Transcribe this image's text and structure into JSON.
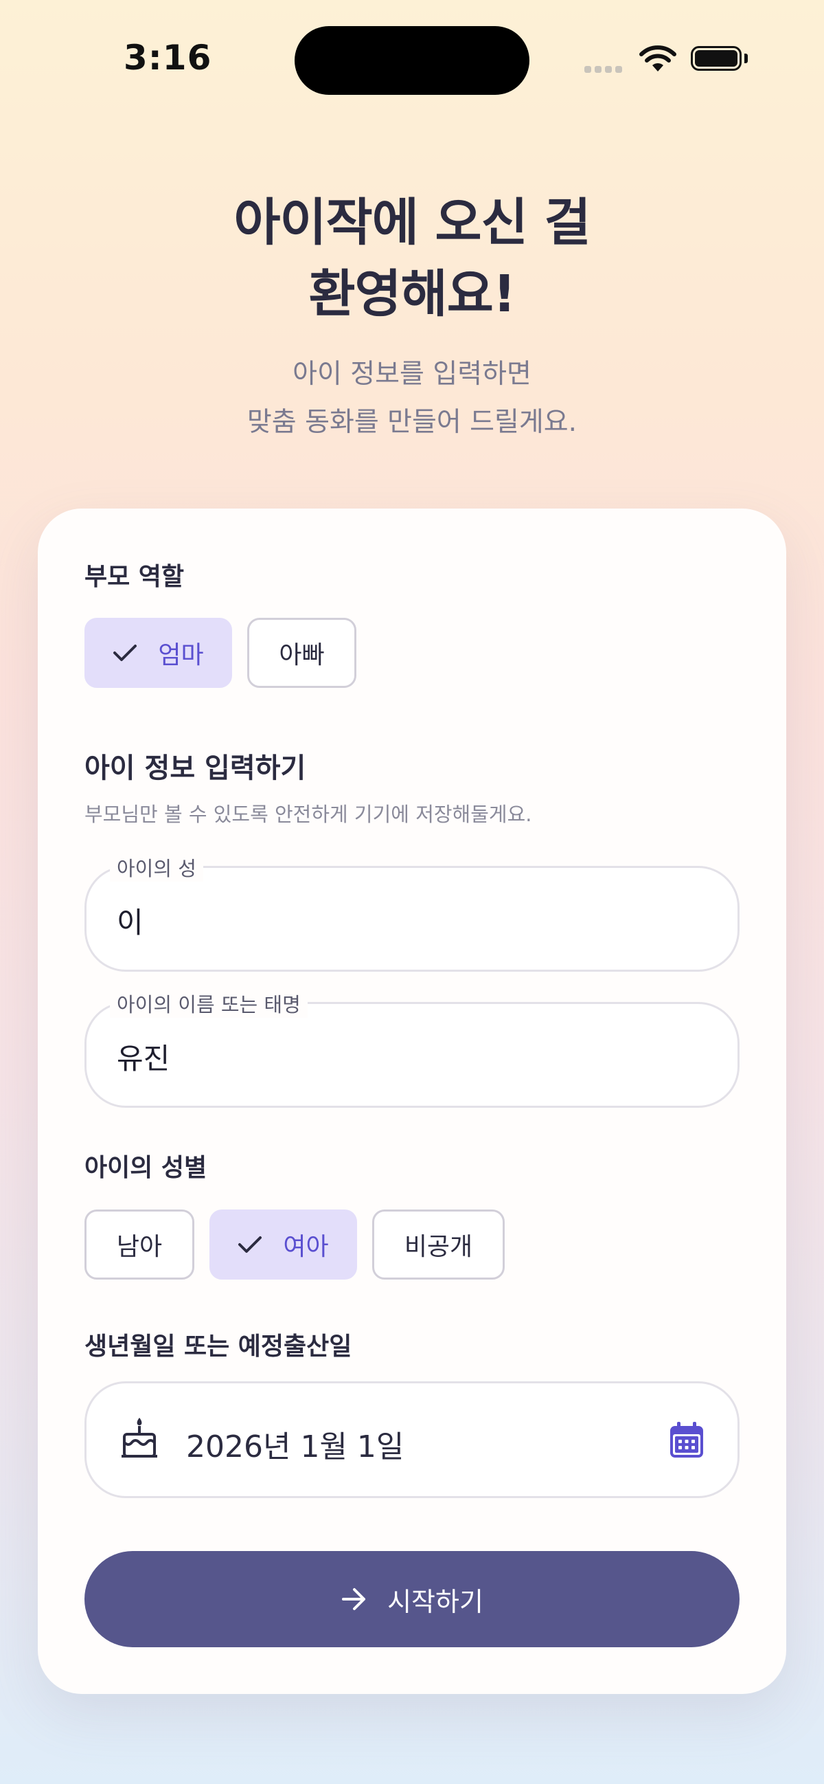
{
  "status_bar": {
    "time": "3:16"
  },
  "header": {
    "title": "아이작에 오신 걸\n환영해요!",
    "subtitle": "아이 정보를 입력하면\n맞춤 동화를 만들어 드릴게요."
  },
  "parent_role": {
    "label": "부모 역할",
    "options": [
      {
        "label": "엄마",
        "selected": true
      },
      {
        "label": "아빠",
        "selected": false
      }
    ]
  },
  "child_info": {
    "title": "아이 정보 입력하기",
    "helper": "부모님만 볼 수 있도록 안전하게 기기에 저장해둘게요.",
    "last_name": {
      "label": "아이의 성",
      "value": "이"
    },
    "first_name": {
      "label": "아이의 이름 또는 태명",
      "value": "유진"
    }
  },
  "gender": {
    "label": "아이의 성별",
    "options": [
      {
        "label": "남아",
        "selected": false
      },
      {
        "label": "여아",
        "selected": true
      },
      {
        "label": "비공개",
        "selected": false
      }
    ]
  },
  "birth": {
    "label": "생년월일 또는 예정출산일",
    "value": "2026년 1월 1일",
    "icon": "cake-icon",
    "picker_icon": "calendar-icon"
  },
  "start_button": {
    "label": "시작하기",
    "icon": "arrow-right-icon"
  },
  "colors": {
    "accent": "#5a4fd0",
    "chip_selected_bg": "#e3defa",
    "button_bg": "#56568c",
    "calendar_icon": "#5a4fd0"
  }
}
